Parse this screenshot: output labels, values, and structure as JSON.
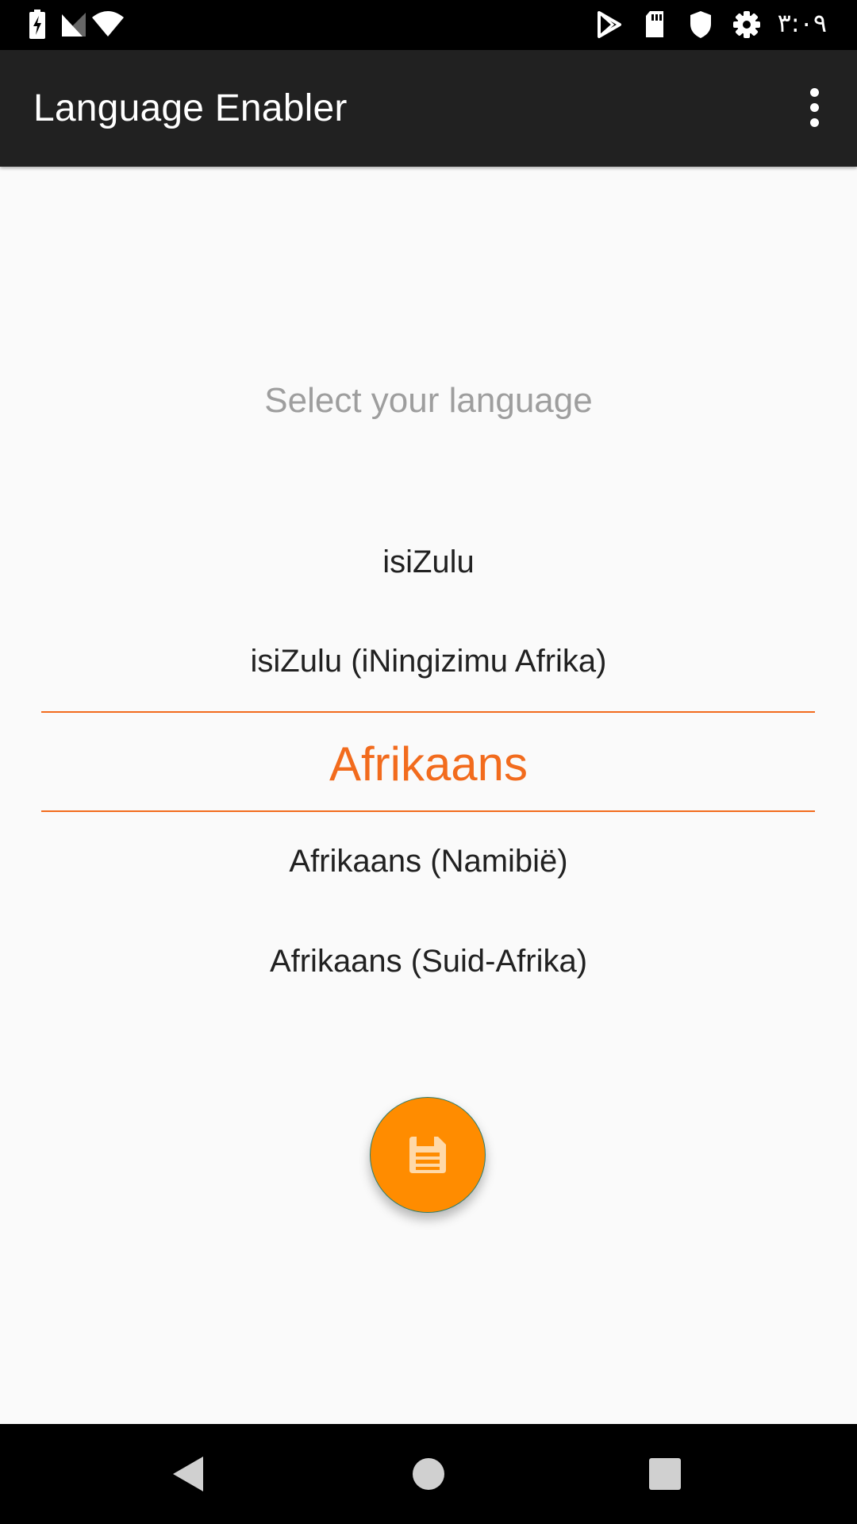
{
  "status_bar": {
    "time": "٣:٠٩",
    "icons": [
      "battery-charging-icon",
      "signal-icon",
      "wifi-icon",
      "play-store-icon",
      "sd-card-icon",
      "shield-icon",
      "settings-gear-icon"
    ]
  },
  "app_bar": {
    "title": "Language Enabler",
    "menu_icon": "more-vert-icon"
  },
  "main": {
    "prompt": "Select your language",
    "picker": {
      "items": [
        "isiZulu",
        "isiZulu (iNingizimu Afrika)",
        "Afrikaans",
        "Afrikaans (Namibië)",
        "Afrikaans (Suid-Afrika)"
      ],
      "selected": "Afrikaans",
      "accent_color": "#f26b1d"
    },
    "save_fab": {
      "icon": "save-floppy-icon",
      "color": "#ff8c00"
    }
  },
  "nav_bar": {
    "icons": [
      "back-icon",
      "home-icon",
      "recents-icon"
    ]
  }
}
